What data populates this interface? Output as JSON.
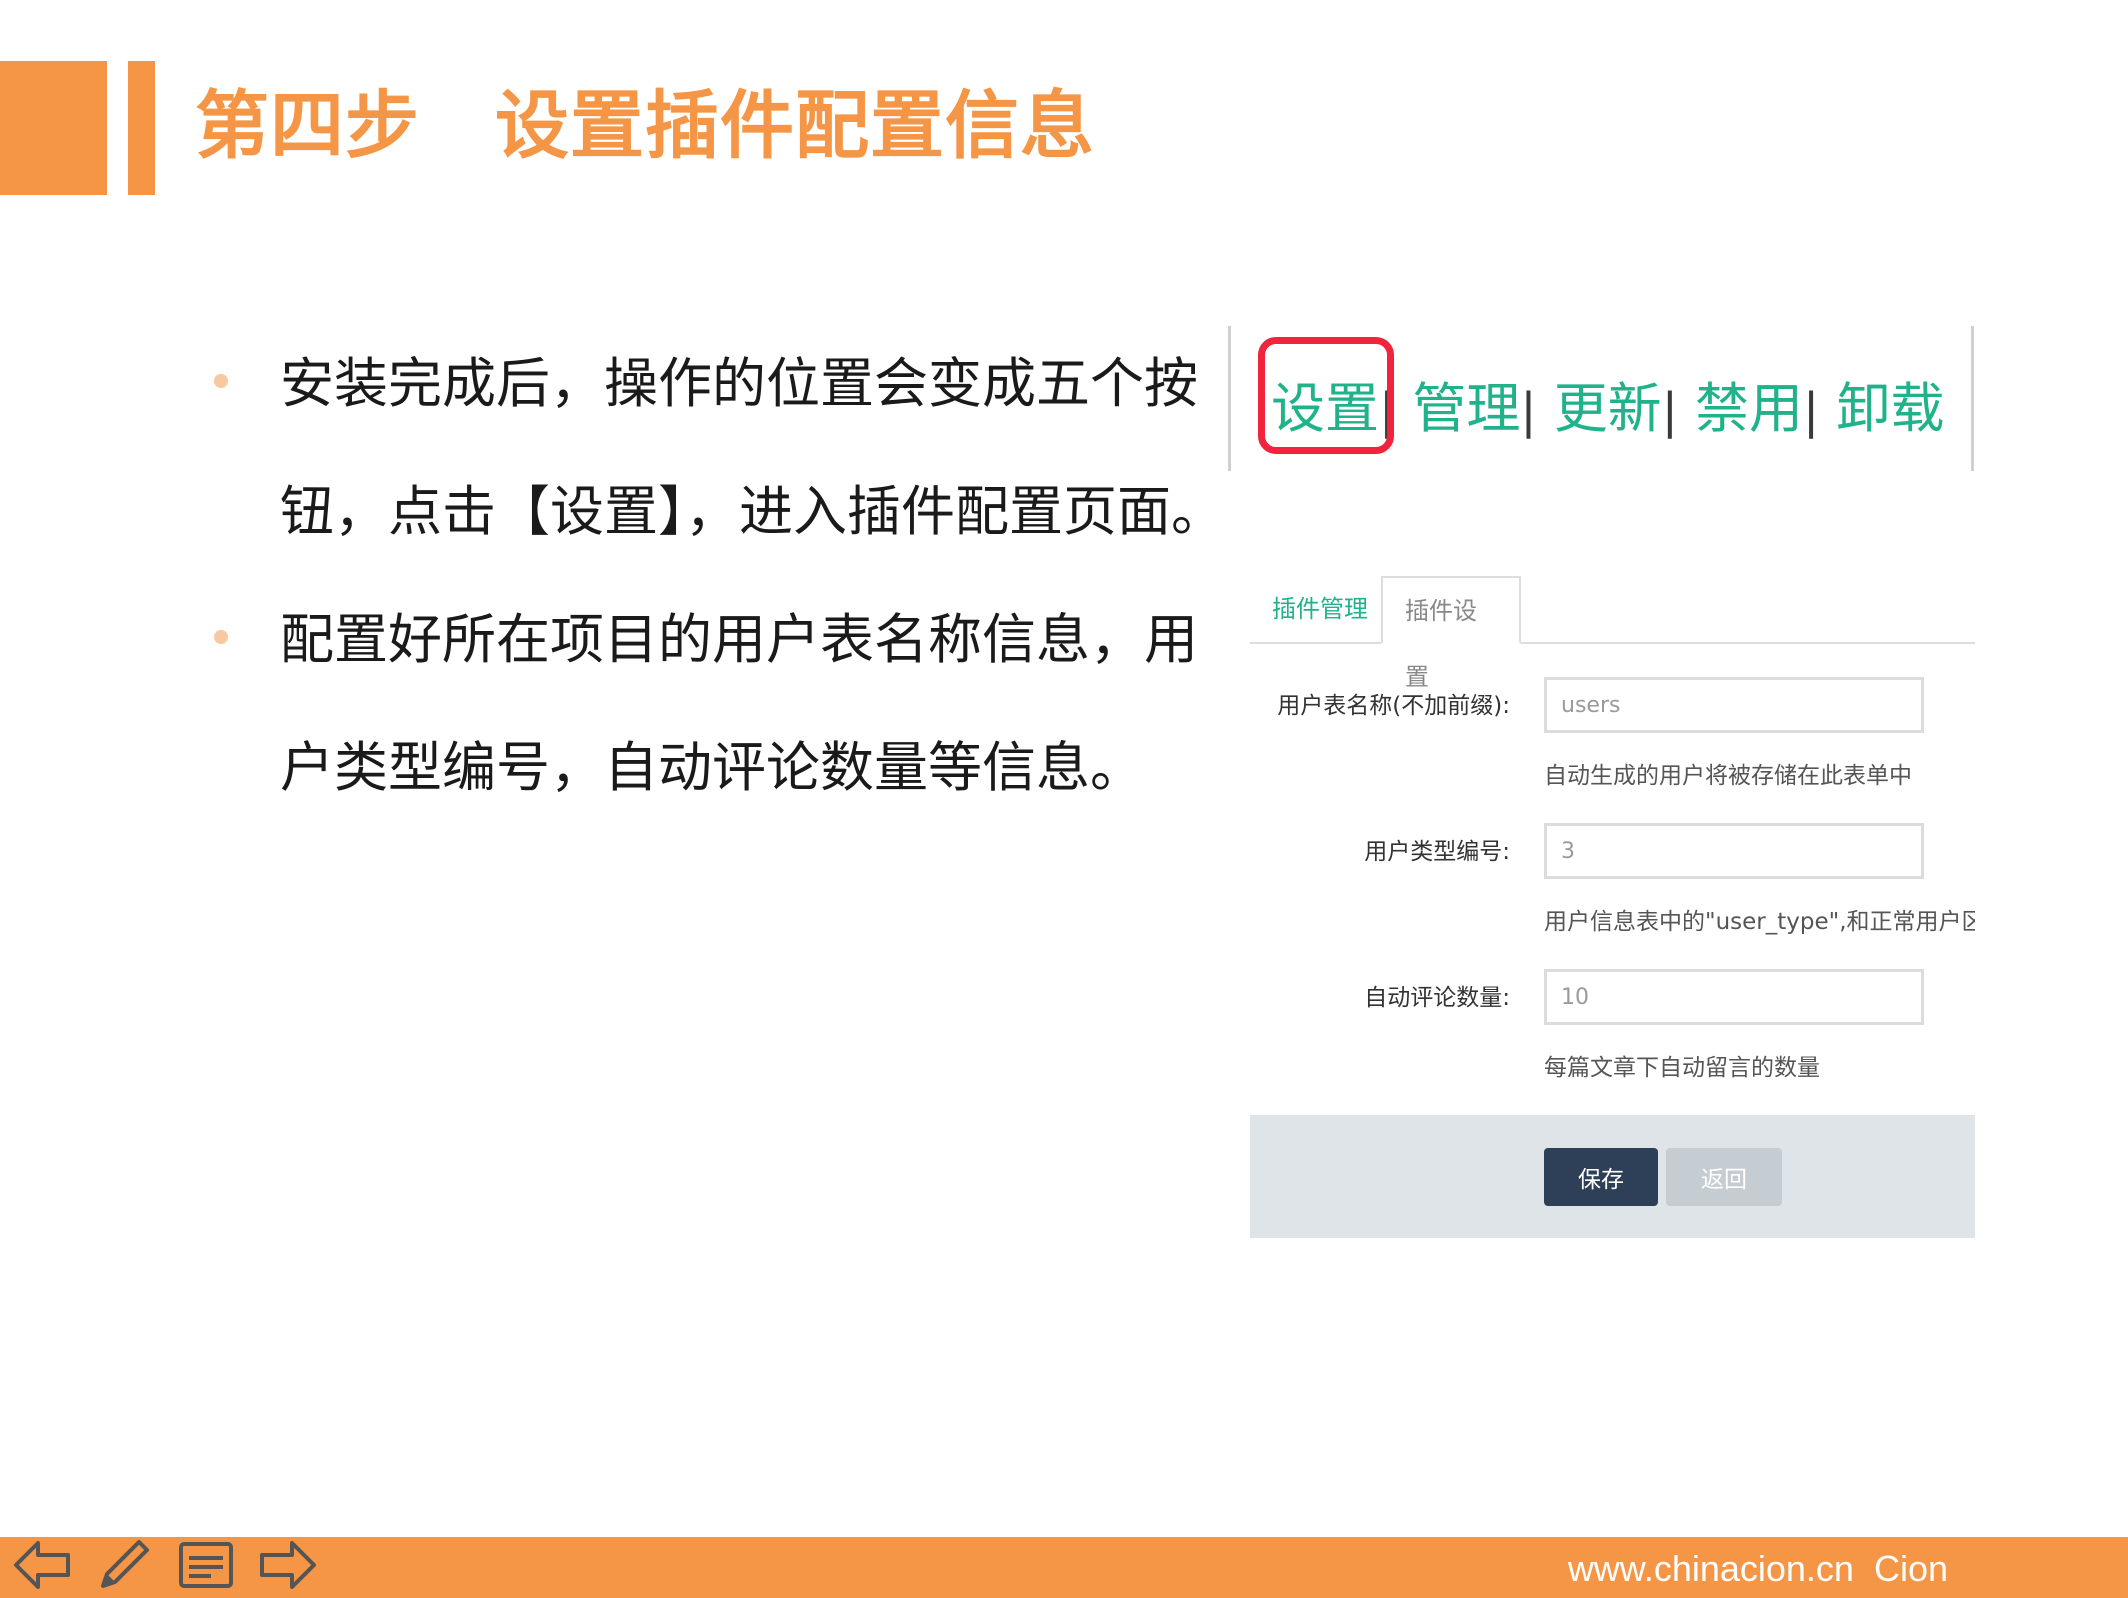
{
  "header": {
    "title": "第四步　设置插件配置信息"
  },
  "bullets": [
    "安装完成后，操作的位置会变成五个按钮，点击【设置】，进入插件配置页面。",
    "配置好所在项目的用户表名称信息，用户类型编号，自动评论数量等信息。"
  ],
  "plugin_actions": {
    "items": [
      "设置",
      "管理",
      "更新",
      "禁用",
      "卸载"
    ],
    "separator": "|",
    "highlighted": "设置",
    "link_color": "#20B28A",
    "highlight_color": "#F0243C"
  },
  "settings_form": {
    "tabs": [
      "插件管理",
      "插件设置"
    ],
    "active_tab": "插件设置",
    "fields": [
      {
        "label": "用户表名称(不加前缀):",
        "value": "users",
        "help": "自动生成的用户将被存储在此表单中"
      },
      {
        "label": "用户类型编号:",
        "value": "3",
        "help": "用户信息表中的\"user_type\",和正常用户区分"
      },
      {
        "label": "自动评论数量:",
        "value": "10",
        "help": "每篇文章下自动留言的数量"
      }
    ],
    "save_label": "保存",
    "back_label": "返回"
  },
  "footer": {
    "text": "www.chinacion.cn  Cion",
    "icons": [
      "arrow-left-icon",
      "pencil-icon",
      "notes-icon",
      "arrow-right-icon"
    ]
  },
  "theme": {
    "accent": "#F59646",
    "dark_button": "#2E4057"
  }
}
